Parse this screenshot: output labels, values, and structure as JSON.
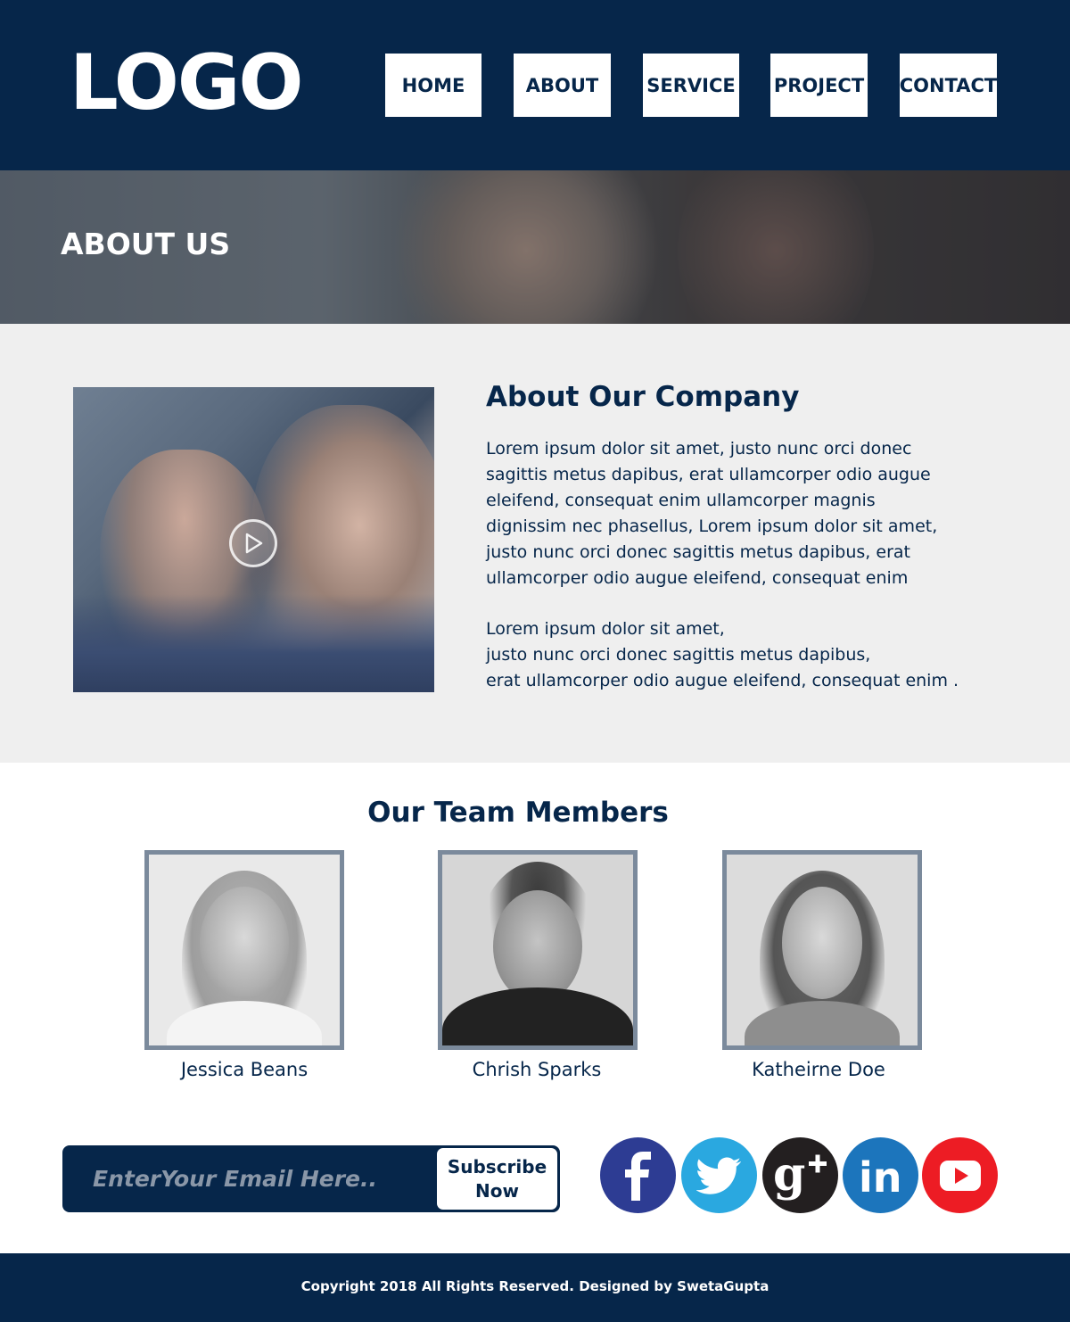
{
  "header": {
    "logo": "LOGO",
    "nav": [
      {
        "label": "HOME"
      },
      {
        "label": "ABOUT"
      },
      {
        "label": "SERVICE"
      },
      {
        "label": "PROJECT"
      },
      {
        "label": "CONTACT"
      }
    ]
  },
  "hero": {
    "title": "ABOUT US"
  },
  "about": {
    "title": "About Our Company",
    "paragraph1": "Lorem ipsum dolor sit amet, justo nunc orci donec\nsagittis metus dapibus, erat ullamcorper odio augue\neleifend, consequat enim ullamcorper magnis\ndignissim nec phasellus, Lorem ipsum dolor sit amet,\njusto nunc orci donec sagittis metus dapibus, erat\nullamcorper odio augue eleifend, consequat enim",
    "paragraph2": "Lorem ipsum dolor sit amet,\njusto nunc orci donec sagittis metus dapibus,\nerat ullamcorper odio augue eleifend, consequat enim ."
  },
  "team": {
    "title": "Our Team Members",
    "members": [
      {
        "name": "Jessica Beans"
      },
      {
        "name": "Chrish Sparks"
      },
      {
        "name": "Katheirne Doe"
      }
    ]
  },
  "subscribe": {
    "placeholder": "EnterYour Email Here..",
    "button_label": "Subscribe\nNow"
  },
  "social": [
    {
      "icon": "facebook-icon",
      "color": "#2d3c93"
    },
    {
      "icon": "twitter-icon",
      "color": "#2aa8e0"
    },
    {
      "icon": "google-plus-icon",
      "color": "#231f20"
    },
    {
      "icon": "linkedin-icon",
      "color": "#1c75bc"
    },
    {
      "icon": "youtube-icon",
      "color": "#ed1c24"
    }
  ],
  "footer": {
    "copyright": "Copyright 2018 All Rights Reserved. Designed by SwetaGupta"
  },
  "colors": {
    "primary": "#06264a",
    "section_bg": "#efefef",
    "photo_border": "#7b8a9c"
  }
}
